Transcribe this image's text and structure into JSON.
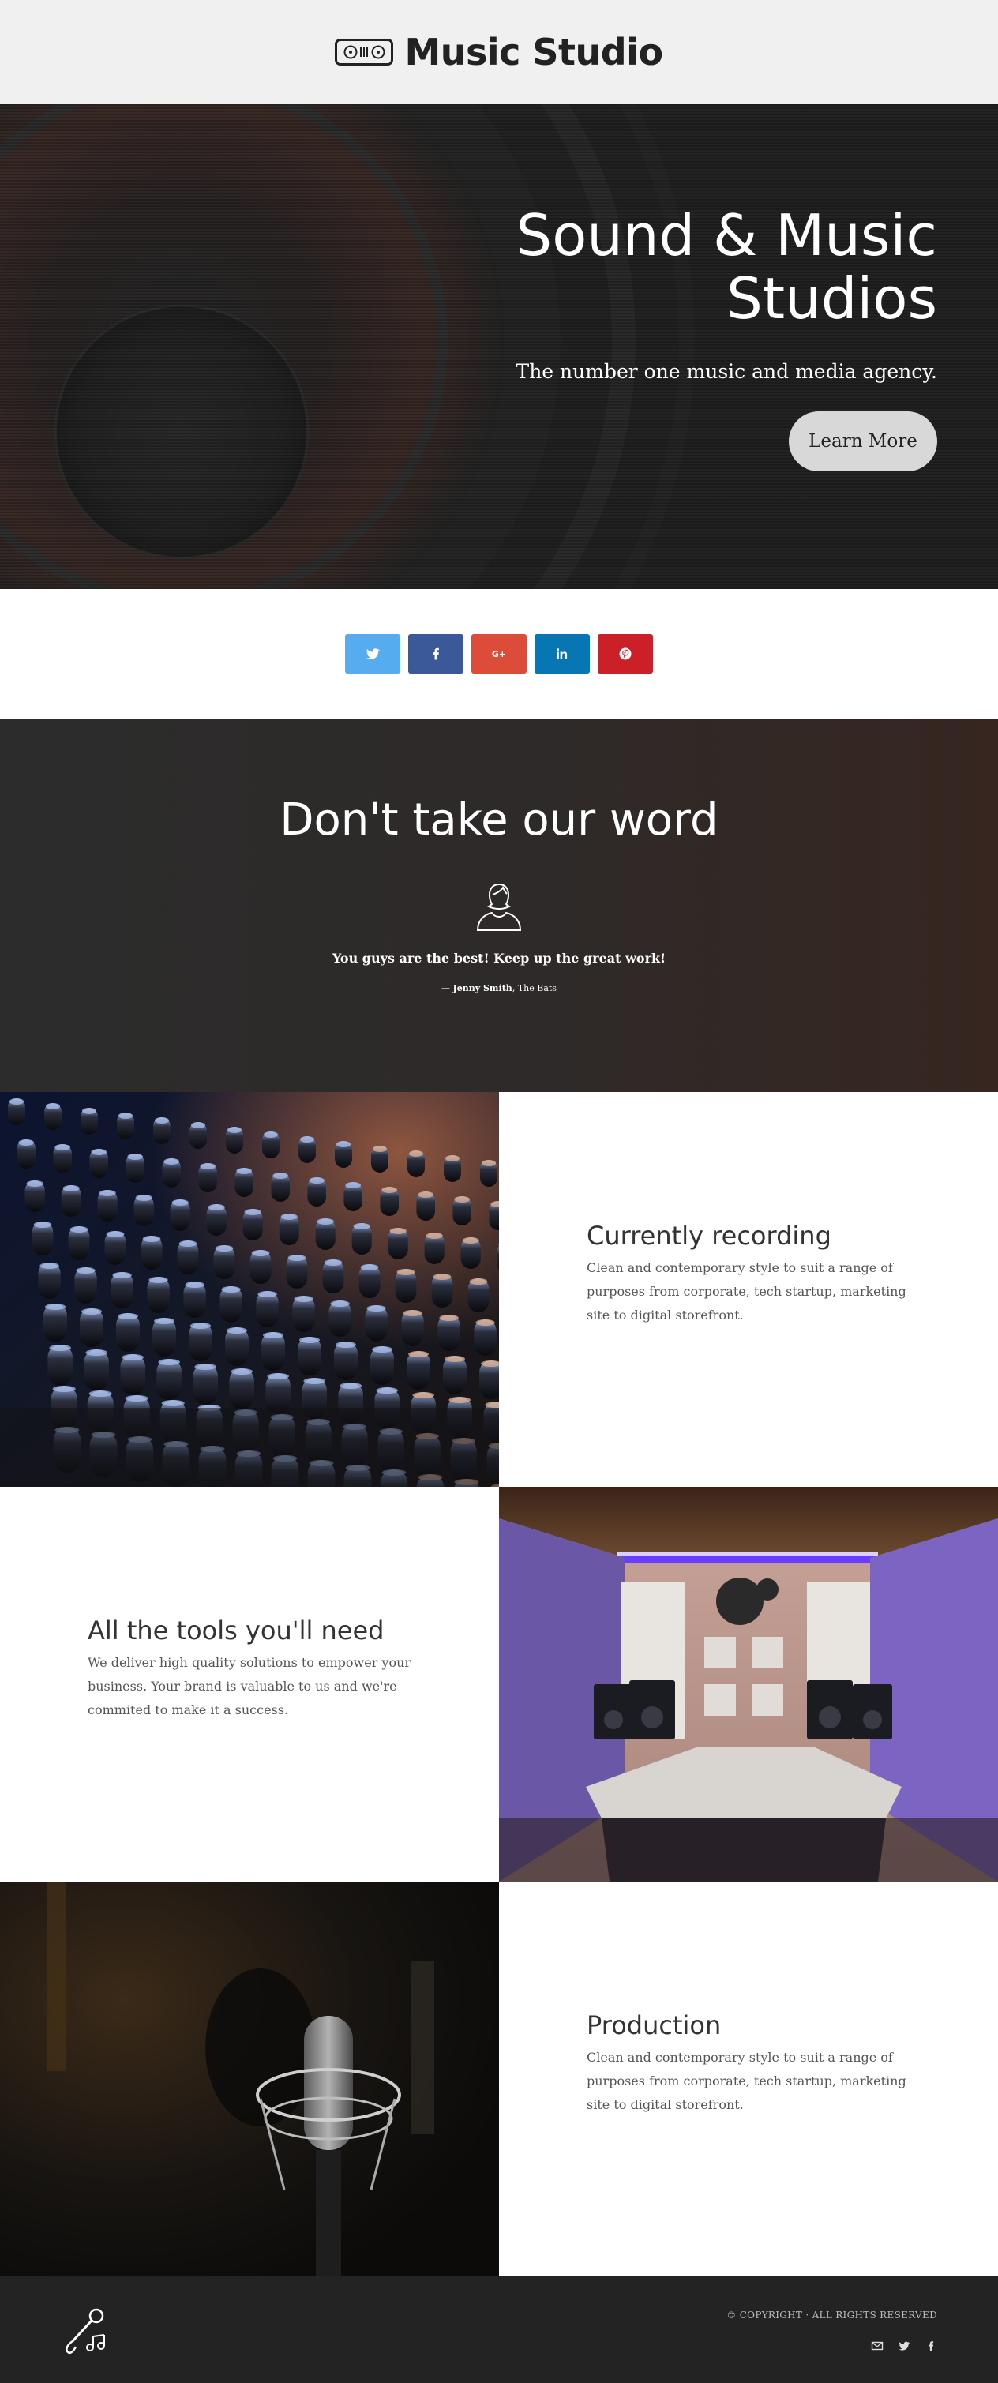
{
  "header": {
    "logo_icon": "turntable-logo-icon",
    "title": "Music Studio"
  },
  "hero": {
    "title_line1": "Sound & Music",
    "title_line2": "Studios",
    "subtitle": "The number one music and media agency.",
    "button_label": "Learn More"
  },
  "share": {
    "buttons": [
      {
        "name": "twitter",
        "icon": "twitter-icon",
        "color": "#55acee"
      },
      {
        "name": "facebook",
        "icon": "facebook-icon",
        "color": "#3b5998"
      },
      {
        "name": "google-plus",
        "icon": "google-plus-icon",
        "color": "#dd4b39"
      },
      {
        "name": "linkedin",
        "icon": "linkedin-icon",
        "color": "#0976b4"
      },
      {
        "name": "pinterest",
        "icon": "pinterest-icon",
        "color": "#cb2027"
      }
    ]
  },
  "testimonial": {
    "title": "Don't take our word",
    "icon": "user-icon",
    "quote": "You guys are the best! Keep up the great work!",
    "author_prefix": "— ",
    "author": "Jenny Smith",
    "company": ", The Bats"
  },
  "features": [
    {
      "title": "Currently recording",
      "body": "Clean and contemporary style to suit a range of purposes from corporate, tech startup, marketing site to digital storefront.",
      "image": "mixing-console-photo"
    },
    {
      "title": "All the tools you'll need",
      "body": "We deliver high quality solutions to empower your business. Your brand is valuable to us and we're commited to make it a success.",
      "image": "studio-room-photo"
    },
    {
      "title": "Production",
      "body": "Clean and contemporary style to suit a range of purposes from corporate, tech startup, marketing site to digital storefront.",
      "image": "microphone-photo"
    }
  ],
  "footer": {
    "logo_icon": "microphone-note-icon",
    "copyright": "© COPYRIGHT · ALL RIGHTS RESERVED",
    "icons": [
      "email-icon",
      "twitter-icon",
      "facebook-icon"
    ]
  },
  "colors": {
    "header_bg": "#f0f0f0",
    "hero_bg": "#232323",
    "footer_bg": "#232323",
    "button_bg": "#d8d8d8"
  }
}
